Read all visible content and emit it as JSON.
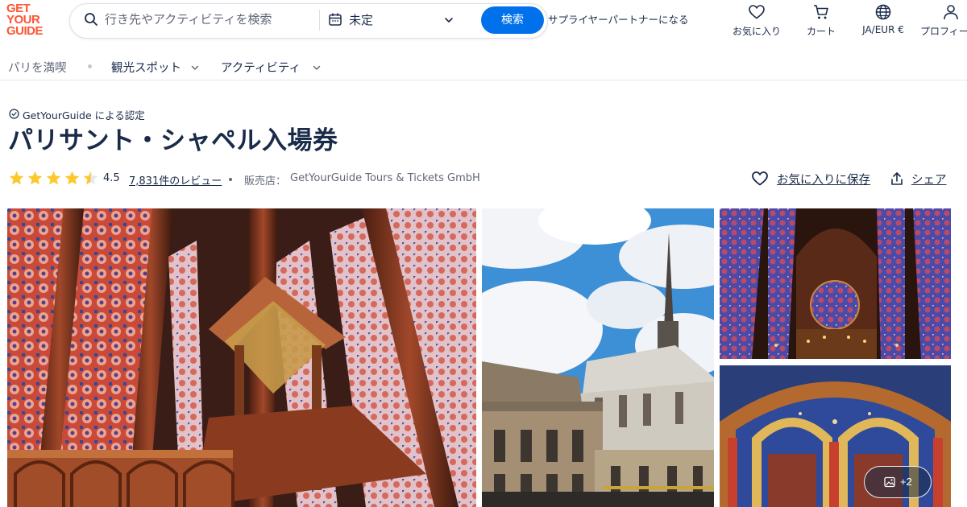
{
  "logo": {
    "line1": "GET",
    "line2": "YOUR",
    "line3": "GUIDE"
  },
  "search": {
    "placeholder": "行き先やアクティビティを検索",
    "date_label": "未定",
    "button_label": "検索"
  },
  "header": {
    "partner_link": "サプライヤーパートナーになる",
    "nav": [
      {
        "icon": "heart-icon",
        "label": "お気に入り"
      },
      {
        "icon": "cart-icon",
        "label": "カート"
      },
      {
        "icon": "globe-icon",
        "label": "JA/EUR €"
      },
      {
        "icon": "profile-icon",
        "label": "プロフィー"
      }
    ]
  },
  "subnav": {
    "home": "パリを満喫",
    "items": [
      "観光スポット",
      "アクティビティ"
    ]
  },
  "product": {
    "verified_text": "GetYourGuide による認定",
    "title": "パリサント・シャペル入場券",
    "rating": 4.5,
    "rating_text": "4.5",
    "reviews_link": "7,831件のレビュー",
    "seller_label": "販売店：",
    "seller_name": "GetYourGuide Tours & Tickets GmbH",
    "wishlist_label": "お気に入りに保存",
    "share_label": "シェア"
  },
  "gallery": {
    "more_label": "+2"
  },
  "colors": {
    "brand": "#ff5533",
    "accent": "#0071eb",
    "text": "#1a2b49",
    "star": "#fdc82b"
  }
}
